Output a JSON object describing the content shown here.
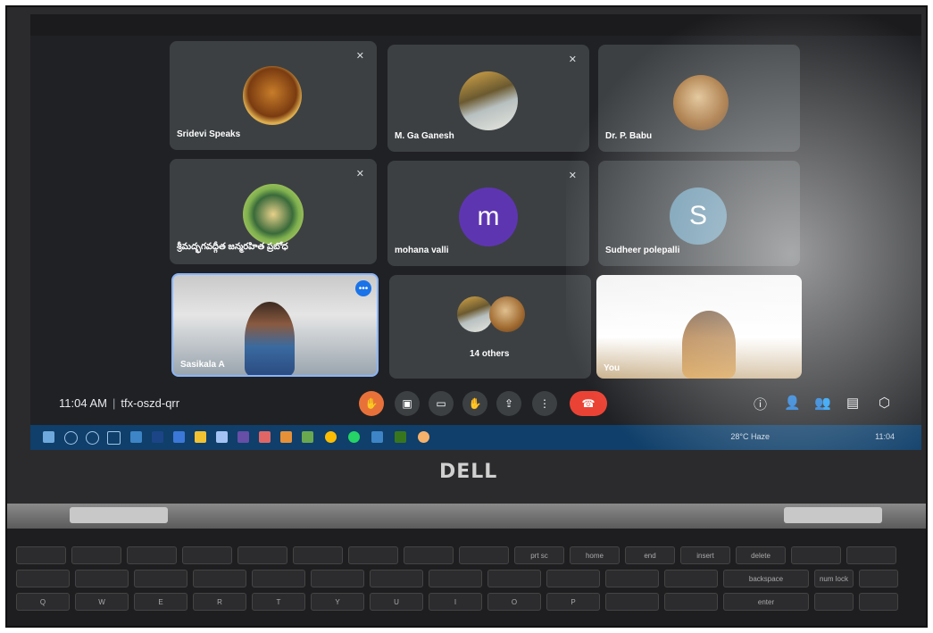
{
  "meeting": {
    "time": "11:04 AM",
    "code": "tfx-oszd-qrr"
  },
  "participants": [
    {
      "name": "Sridevi Speaks"
    },
    {
      "name": "M. Ga Ganesh"
    },
    {
      "name": "Dr. P. Babu"
    },
    {
      "name": "శ్రీమద్భగవద్గీత జన్మరహిత ప్రబోధ"
    },
    {
      "name": "mohana valli",
      "initial": "m",
      "color": "#5e35b1"
    },
    {
      "name": "Sudheer polepalli",
      "initial": "S"
    },
    {
      "name": "Sasikala A"
    },
    {
      "name": "14 others"
    },
    {
      "name": "You"
    }
  ],
  "taskbar": {
    "weather": "28°C Haze",
    "clock": "11:04"
  },
  "brand": "DELL",
  "keys": [
    "Q",
    "W",
    "E",
    "R",
    "T",
    "Y",
    "U",
    "I",
    "O",
    "P",
    "backspace",
    "num lock",
    "enter",
    "home",
    "end",
    "insert",
    "delete",
    "prt sc"
  ]
}
